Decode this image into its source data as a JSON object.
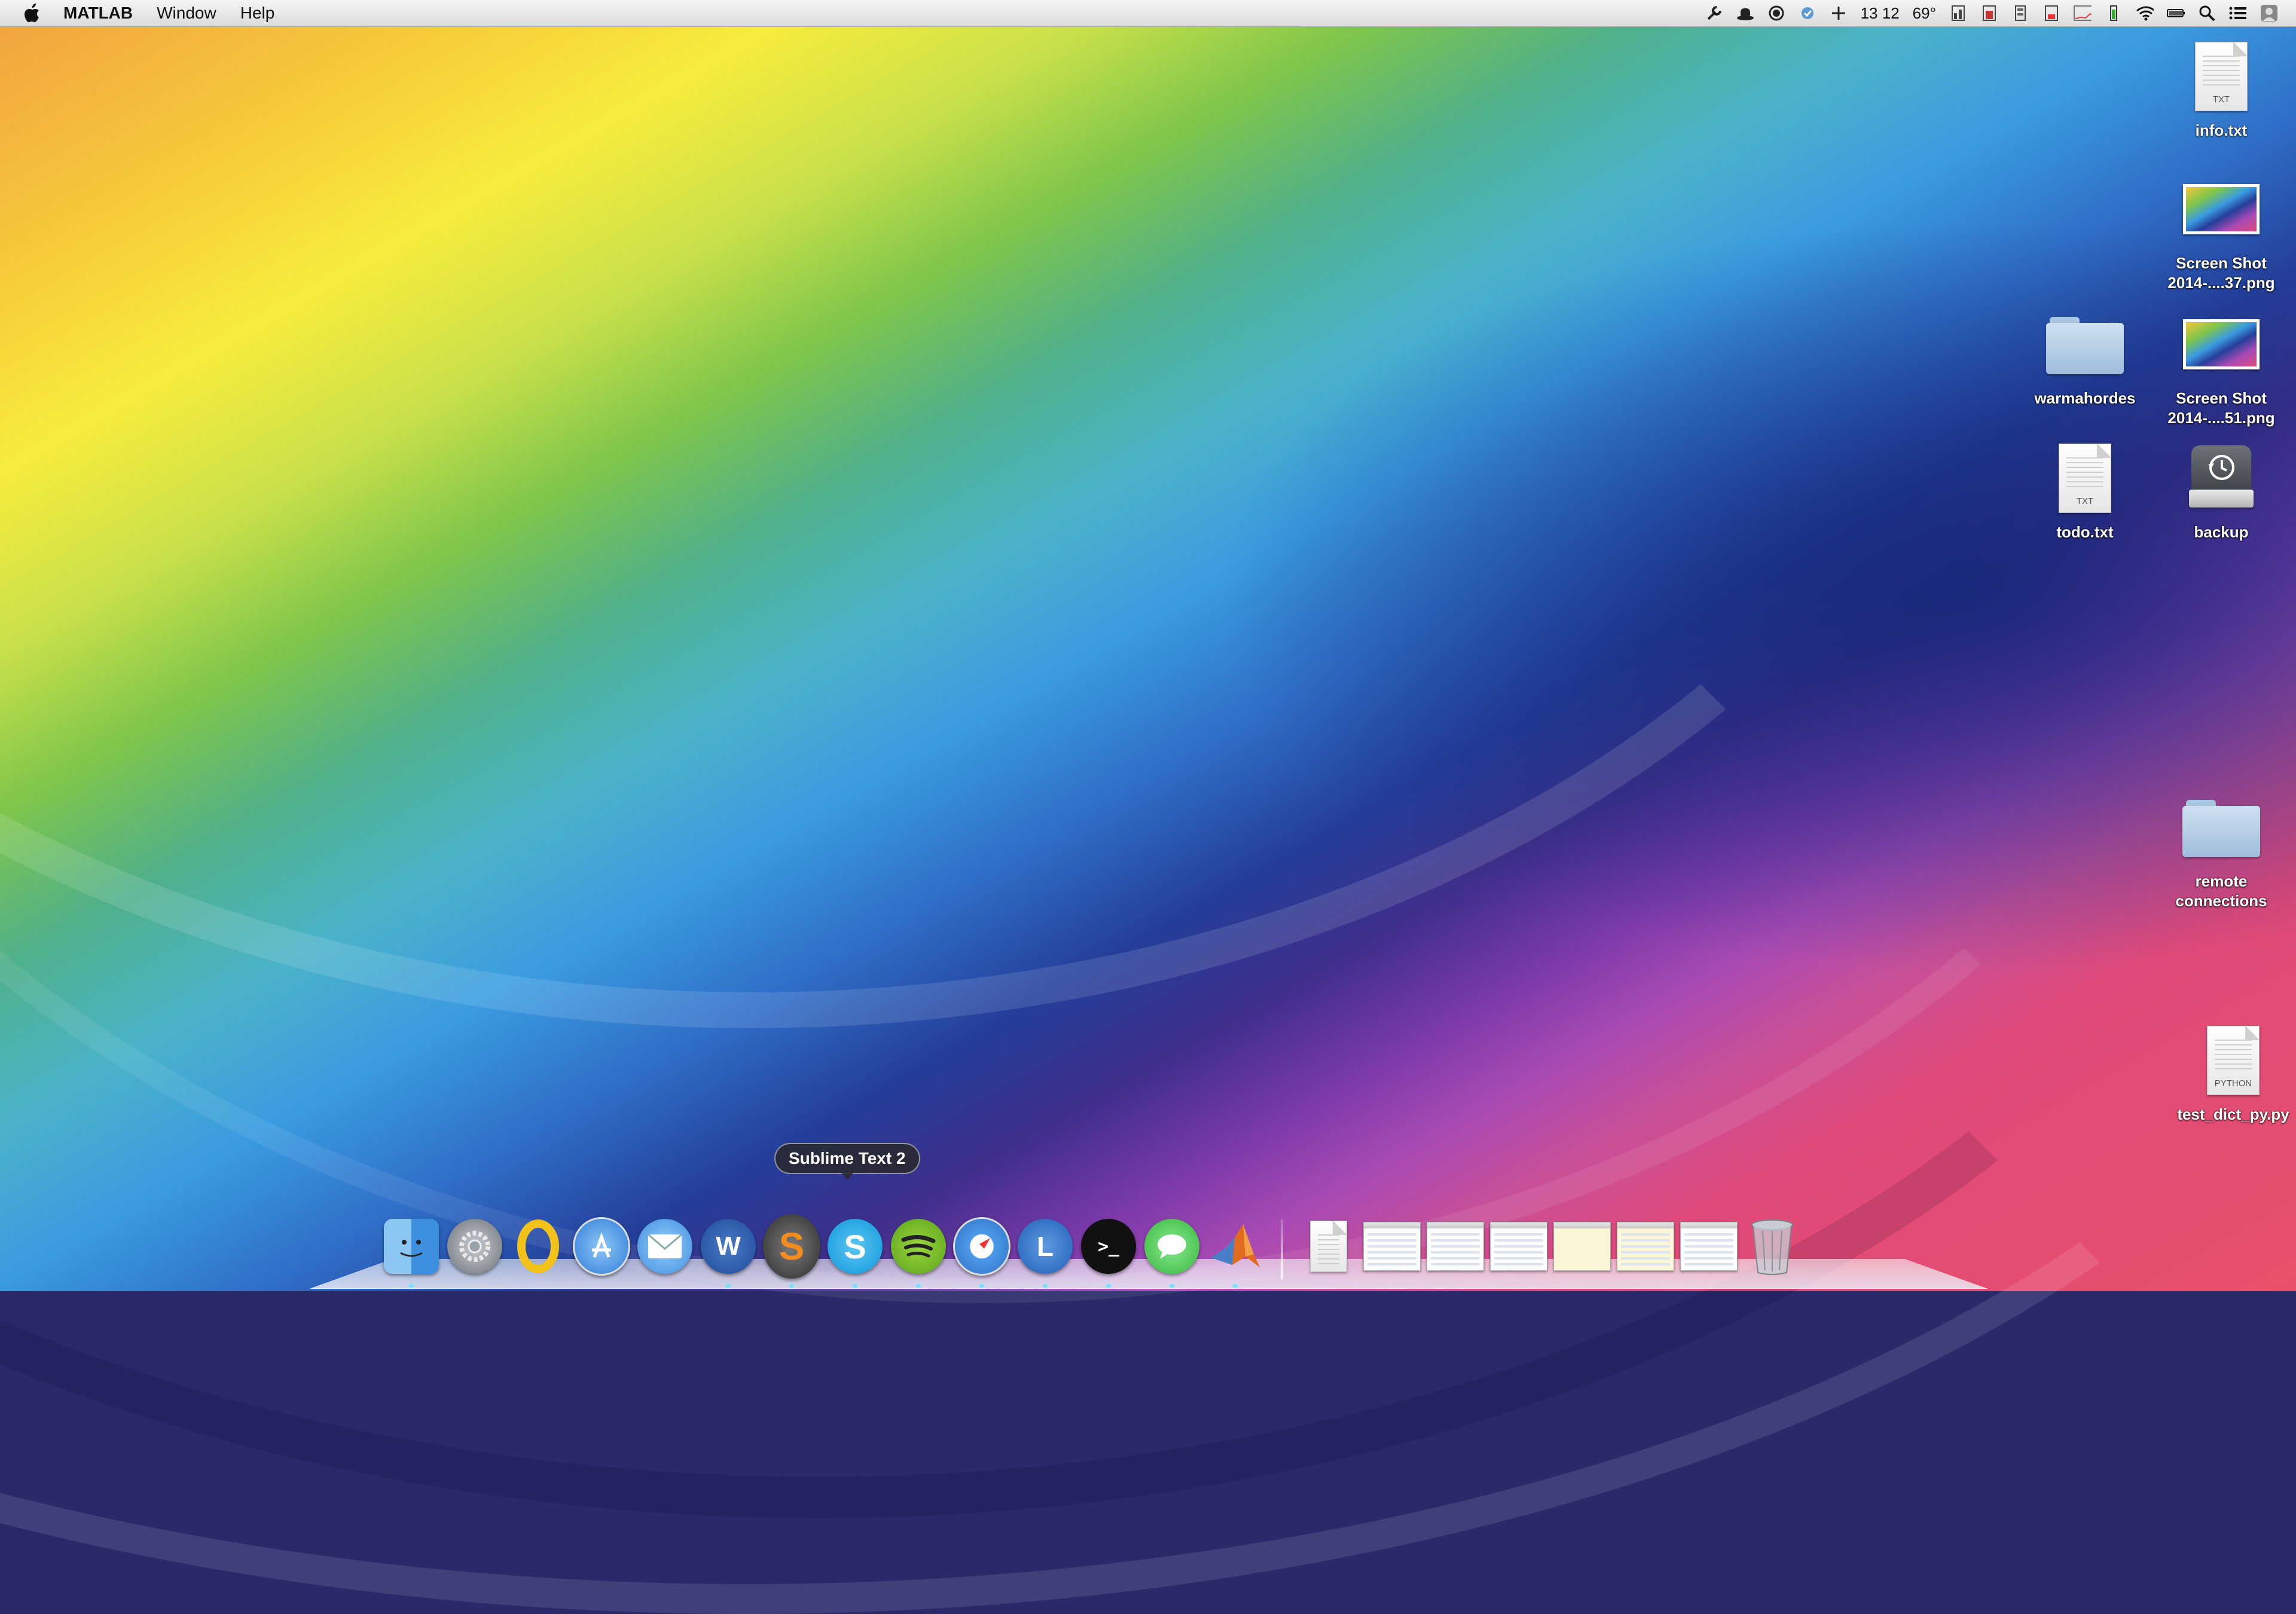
{
  "menubar": {
    "app_name": "MATLAB",
    "menus": [
      "Window",
      "Help"
    ],
    "status": {
      "clock": "13 12",
      "temperature": "69°"
    }
  },
  "desktop": {
    "icons": [
      {
        "name": "info.txt",
        "kind": "text-file",
        "ext": "TXT"
      },
      {
        "name": "Screen Shot 2014-....37.png",
        "kind": "image-file"
      },
      {
        "name": "warmahordes",
        "kind": "folder"
      },
      {
        "name": "Screen Shot 2014-....51.png",
        "kind": "image-file"
      },
      {
        "name": "todo.txt",
        "kind": "text-file",
        "ext": "TXT"
      },
      {
        "name": "backup",
        "kind": "time-machine-drive"
      },
      {
        "name": "remote connections",
        "kind": "folder"
      },
      {
        "name": "test_dict_py.py",
        "kind": "python-file",
        "ext": "PYTHON"
      }
    ]
  },
  "dock": {
    "tooltip": "Sublime Text 2",
    "apps": [
      {
        "icon": "finder-icon",
        "color": "#5aa3e8"
      },
      {
        "icon": "system-preferences-icon",
        "color": "#8a8f96"
      },
      {
        "icon": "opera-icon",
        "color": "#f2c21a"
      },
      {
        "icon": "app-store-icon",
        "color": "#3a8be0"
      },
      {
        "icon": "mail-icon",
        "color": "#4aa0ea"
      },
      {
        "icon": "word-icon",
        "color": "#2b5aa8",
        "glyph": "W"
      },
      {
        "icon": "sublime-text-icon",
        "color": "#4a4a4a",
        "glyph": "S"
      },
      {
        "icon": "skype-icon",
        "color": "#19a8e8",
        "glyph": "S"
      },
      {
        "icon": "spotify-icon",
        "color": "#2a2a2a"
      },
      {
        "icon": "safari-icon",
        "color": "#3f8fe6"
      },
      {
        "icon": "lync-icon",
        "color": "#2f72c8",
        "glyph": "L"
      },
      {
        "icon": "terminal-icon",
        "color": "#111111",
        "glyph": ">_"
      },
      {
        "icon": "messages-icon",
        "color": "#4cd15a"
      },
      {
        "icon": "matlab-icon",
        "color": "#e06a20"
      }
    ]
  }
}
